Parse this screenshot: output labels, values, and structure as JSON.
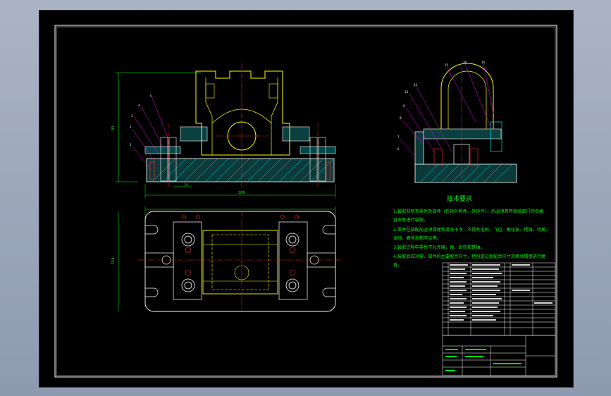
{
  "drawing": {
    "tech_req_title": "技术要求",
    "tech_req_lines": [
      "1.装配前所有零件及部件（包括外购件、外协件），均必须具有检验部门的合格",
      "证方能进行装配。",
      "2.零件在装配前必须清理和清洗干净，不得有毛刺、飞边、氧化皮、锈蚀、切屑、",
      "油污、着色剂和灰尘等。",
      "3.装配过程中零件不允许磕、碰、划伤和锈蚀。",
      "4.装配后应对零、部件的主要配合尺寸，特别是过盈配合尺寸及相关精度进行复",
      "查。"
    ],
    "colors": {
      "outline": "#ffffff",
      "part": "#ffff00",
      "center": "#ff2020",
      "hatch": "#00e5e5",
      "dimension": "#00ff00",
      "leader": "#ff00ff",
      "frame": "#ffffff"
    },
    "icons": [
      "balloon-number-icon"
    ]
  }
}
